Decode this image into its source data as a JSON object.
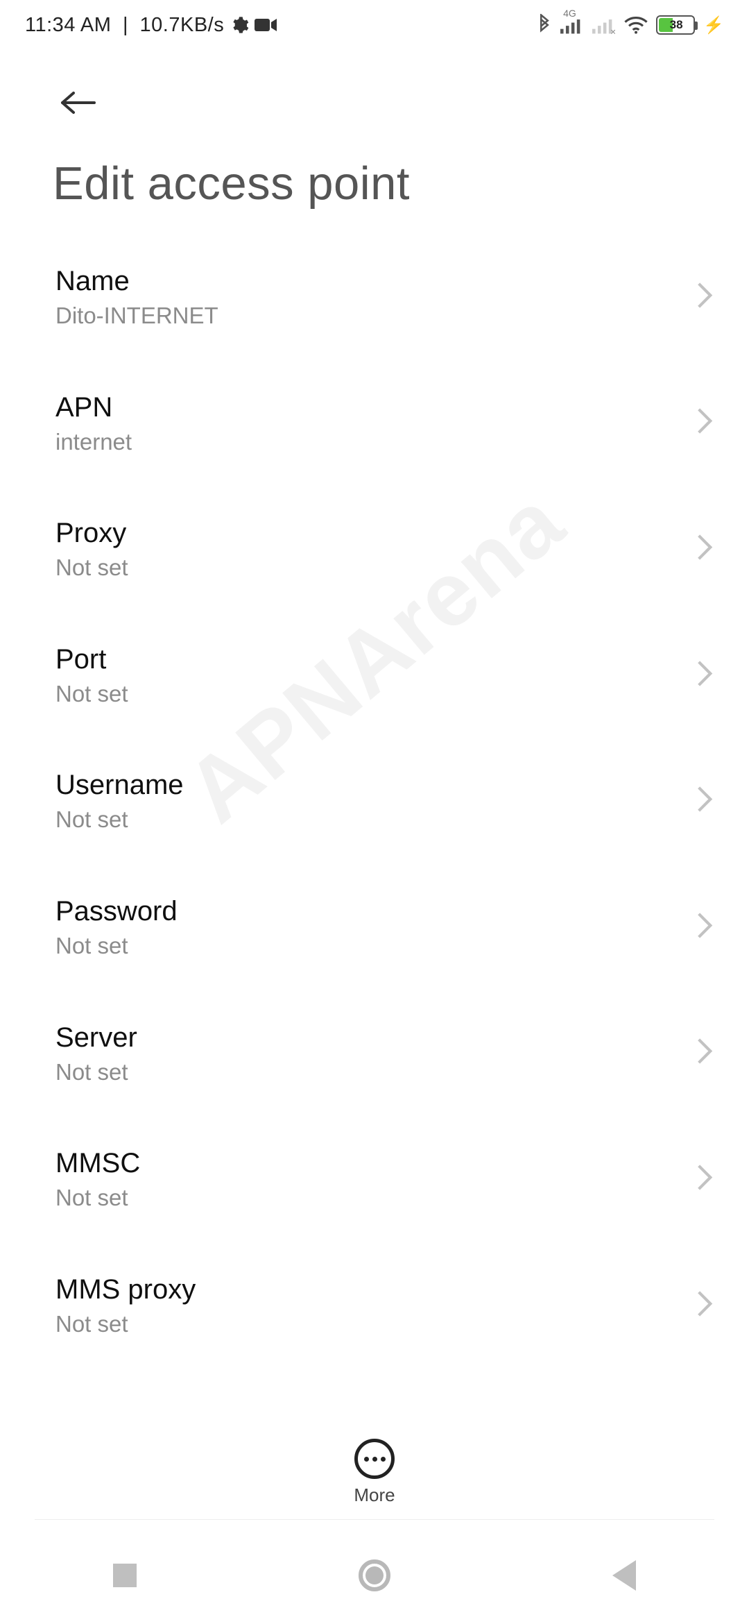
{
  "statusbar": {
    "time": "11:34 AM",
    "data_rate": "10.7KB/s",
    "network_badge": "4G",
    "battery_percent": "38"
  },
  "header": {
    "title": "Edit access point"
  },
  "settings": [
    {
      "key": "name",
      "label": "Name",
      "value": "Dito-INTERNET"
    },
    {
      "key": "apn",
      "label": "APN",
      "value": "internet"
    },
    {
      "key": "proxy",
      "label": "Proxy",
      "value": "Not set"
    },
    {
      "key": "port",
      "label": "Port",
      "value": "Not set"
    },
    {
      "key": "username",
      "label": "Username",
      "value": "Not set"
    },
    {
      "key": "password",
      "label": "Password",
      "value": "Not set"
    },
    {
      "key": "server",
      "label": "Server",
      "value": "Not set"
    },
    {
      "key": "mmsc",
      "label": "MMSC",
      "value": "Not set"
    },
    {
      "key": "mms_proxy",
      "label": "MMS proxy",
      "value": "Not set"
    }
  ],
  "bottombar": {
    "more_label": "More"
  },
  "watermark": "APNArena"
}
